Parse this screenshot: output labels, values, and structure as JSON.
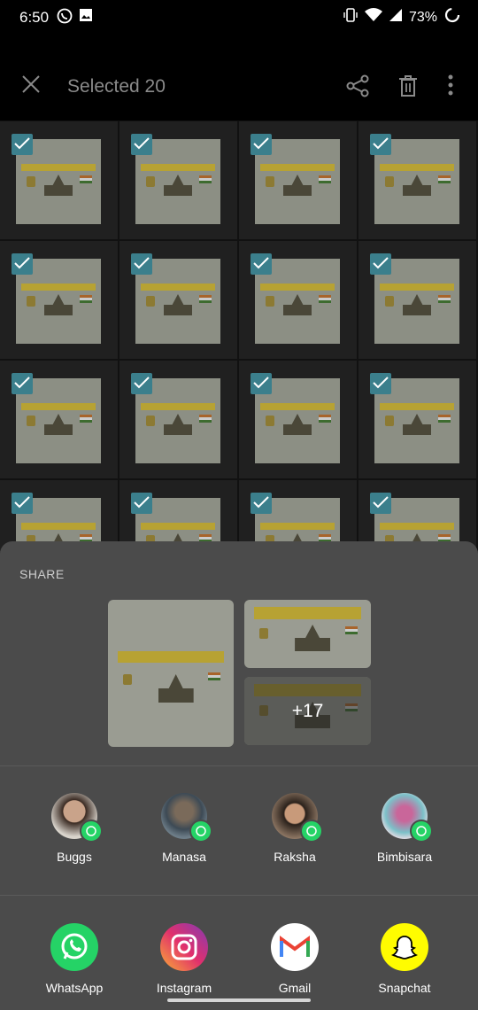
{
  "status_bar": {
    "time": "6:50",
    "battery": "73%"
  },
  "top_bar": {
    "title": "Selected 20"
  },
  "grid": {
    "selected_count": 16
  },
  "share_sheet": {
    "label": "SHARE",
    "more_count": "+17",
    "contacts": [
      {
        "name": "Buggs"
      },
      {
        "name": "Manasa"
      },
      {
        "name": "Raksha"
      },
      {
        "name": "Bimbisara"
      }
    ],
    "apps": [
      {
        "name": "WhatsApp",
        "icon": "whatsapp-icon",
        "color": "#25d366"
      },
      {
        "name": "Instagram",
        "icon": "instagram-icon",
        "color": "#d62976"
      },
      {
        "name": "Gmail",
        "icon": "gmail-icon",
        "color": "#ffffff"
      },
      {
        "name": "Snapchat",
        "icon": "snapchat-icon",
        "color": "#fffc00"
      }
    ]
  }
}
